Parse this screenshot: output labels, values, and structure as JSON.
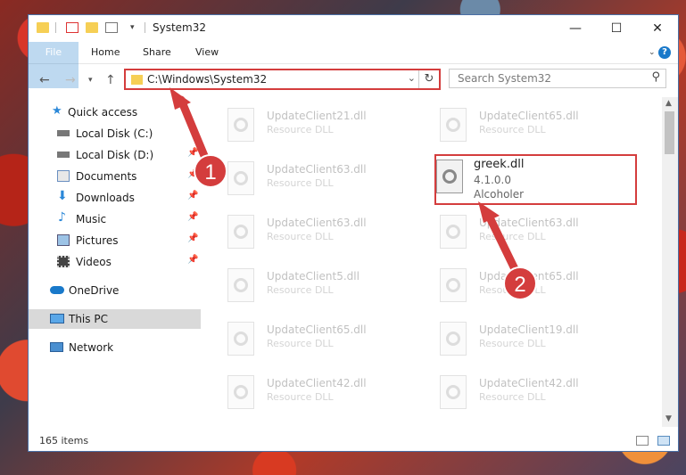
{
  "window": {
    "title": "System32",
    "controls": {
      "minimize": "—",
      "maximize": "☐",
      "close": "✕"
    }
  },
  "ribbon": {
    "tabs": [
      {
        "label": "File"
      },
      {
        "label": "Home"
      },
      {
        "label": "Share"
      },
      {
        "label": "View"
      }
    ],
    "help": "?"
  },
  "address_bar": {
    "path": "C:\\Windows\\System32",
    "dropdown": "⌄",
    "refresh": "↻"
  },
  "search": {
    "placeholder": "Search System32",
    "icon": "⚲"
  },
  "sidebar": {
    "items": [
      {
        "label": "Quick access",
        "icon": "star-icon"
      },
      {
        "label": "Local Disk (C:)",
        "icon": "drive-icon"
      },
      {
        "label": "Local Disk (D:)",
        "icon": "drive-icon"
      },
      {
        "label": "Documents",
        "icon": "documents-icon"
      },
      {
        "label": "Downloads",
        "icon": "download-icon"
      },
      {
        "label": "Music",
        "icon": "music-icon"
      },
      {
        "label": "Pictures",
        "icon": "pictures-icon"
      },
      {
        "label": "Videos",
        "icon": "videos-icon"
      },
      {
        "label": "OneDrive",
        "icon": "cloud-icon"
      },
      {
        "label": "This PC",
        "icon": "computer-icon"
      },
      {
        "label": "Network",
        "icon": "network-icon"
      }
    ]
  },
  "files": {
    "left": [
      {
        "name": "UpdateClient21.dll",
        "desc": "Resource DLL"
      },
      {
        "name": "UpdateClient63.dll",
        "desc": "Resource DLL"
      },
      {
        "name": "UpdateClient63.dll",
        "desc": "Resource DLL"
      },
      {
        "name": "UpdateClient5.dll",
        "desc": "Resource DLL"
      },
      {
        "name": "UpdateClient65.dll",
        "desc": "Resource DLL"
      },
      {
        "name": "UpdateClient42.dll",
        "desc": "Resource DLL"
      }
    ],
    "right": [
      {
        "name": "UpdateClient65.dll",
        "desc": "Resource DLL"
      },
      {
        "name": "greek.dll",
        "desc": "4.1.0.0",
        "desc2": "Alcoholer"
      },
      {
        "name": "UpdateClient63.dll",
        "desc": "Resource DLL"
      },
      {
        "name": "UpdateClient65.dll",
        "desc": "Resource DLL"
      },
      {
        "name": "UpdateClient19.dll",
        "desc": "Resource DLL"
      },
      {
        "name": "UpdateClient42.dll",
        "desc": "Resource DLL"
      }
    ]
  },
  "status": {
    "count": "165 items"
  },
  "callouts": {
    "one": "1",
    "two": "2"
  },
  "colors": {
    "accent": "#1979ca",
    "highlight": "#d43d3d"
  }
}
